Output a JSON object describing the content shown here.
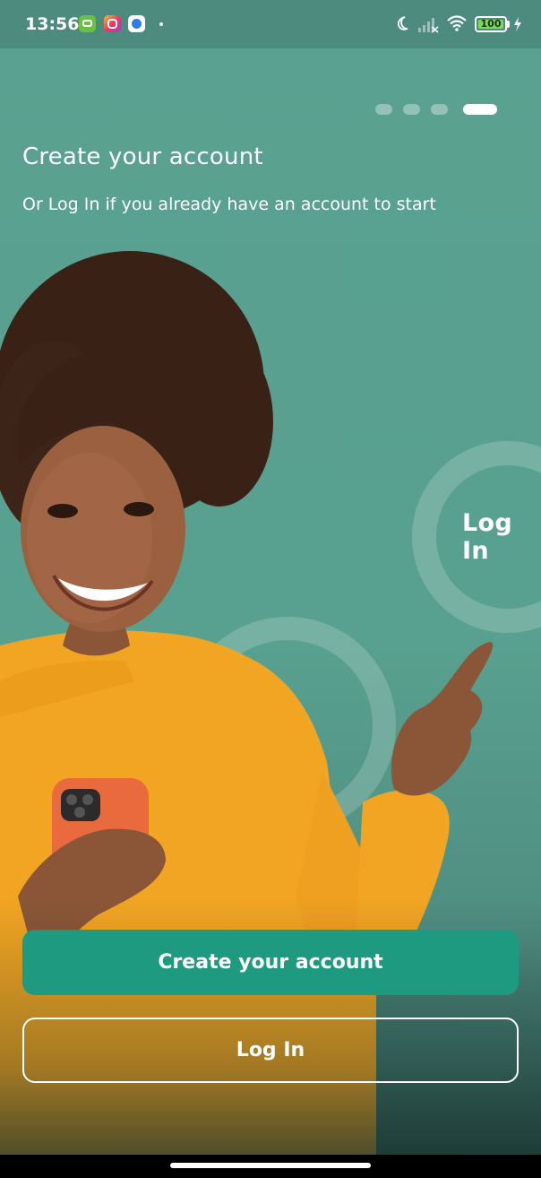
{
  "status_bar": {
    "time": "13:56",
    "battery": "100",
    "icons": [
      "chat-app-icon",
      "instagram-icon",
      "messenger-icon",
      "moon-icon",
      "signal-icon",
      "wifi-icon",
      "battery-icon",
      "charging-bolt-icon"
    ]
  },
  "pager": {
    "total": 4,
    "active_index": 3
  },
  "onboarding": {
    "title": "Create your account",
    "subtitle": "Or Log In if you already have an account to start",
    "ring_label": "Log In"
  },
  "actions": {
    "create_account_label": "Create your account",
    "login_label": "Log In"
  },
  "colors": {
    "background": "#5aa191",
    "primary_button": "#1d9a80",
    "sweater": "#f2a522",
    "phone_case": "#e96a3c"
  }
}
